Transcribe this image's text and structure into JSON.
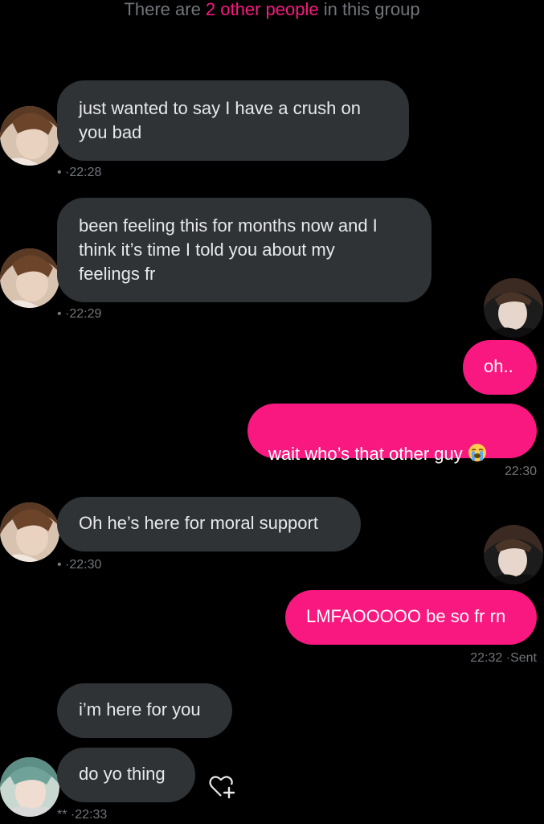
{
  "banner": {
    "prefix": "There are ",
    "highlight": "2 other people",
    "suffix": " in this group"
  },
  "messages": [
    {
      "text": "just wanted to say I have a crush on\nyou bad",
      "meta": "• ·22:28"
    },
    {
      "text": "been feeling this for months now and I\nthink it’s time I told you about my\nfeelings fr",
      "meta": "• ·22:29"
    },
    {
      "text": "oh..",
      "meta": ""
    },
    {
      "text": "wait who’s that other guy",
      "meta": "22:30",
      "emoji": "loudly-crying-face-emoji"
    },
    {
      "text": "Oh he’s here for moral support",
      "meta": "• ·22:30"
    },
    {
      "text": "LMFAOOOOO be so fr rn",
      "meta": "22:32 ·Sent"
    },
    {
      "text": "i’m here for you",
      "meta": ""
    },
    {
      "text": "do yo thing",
      "meta": "** ·22:33"
    }
  ],
  "icons": {
    "react": "heart-plus-icon",
    "accent": "#f91880",
    "incoming_bubble": "#2f3336",
    "meta_gray": "#71767b"
  }
}
